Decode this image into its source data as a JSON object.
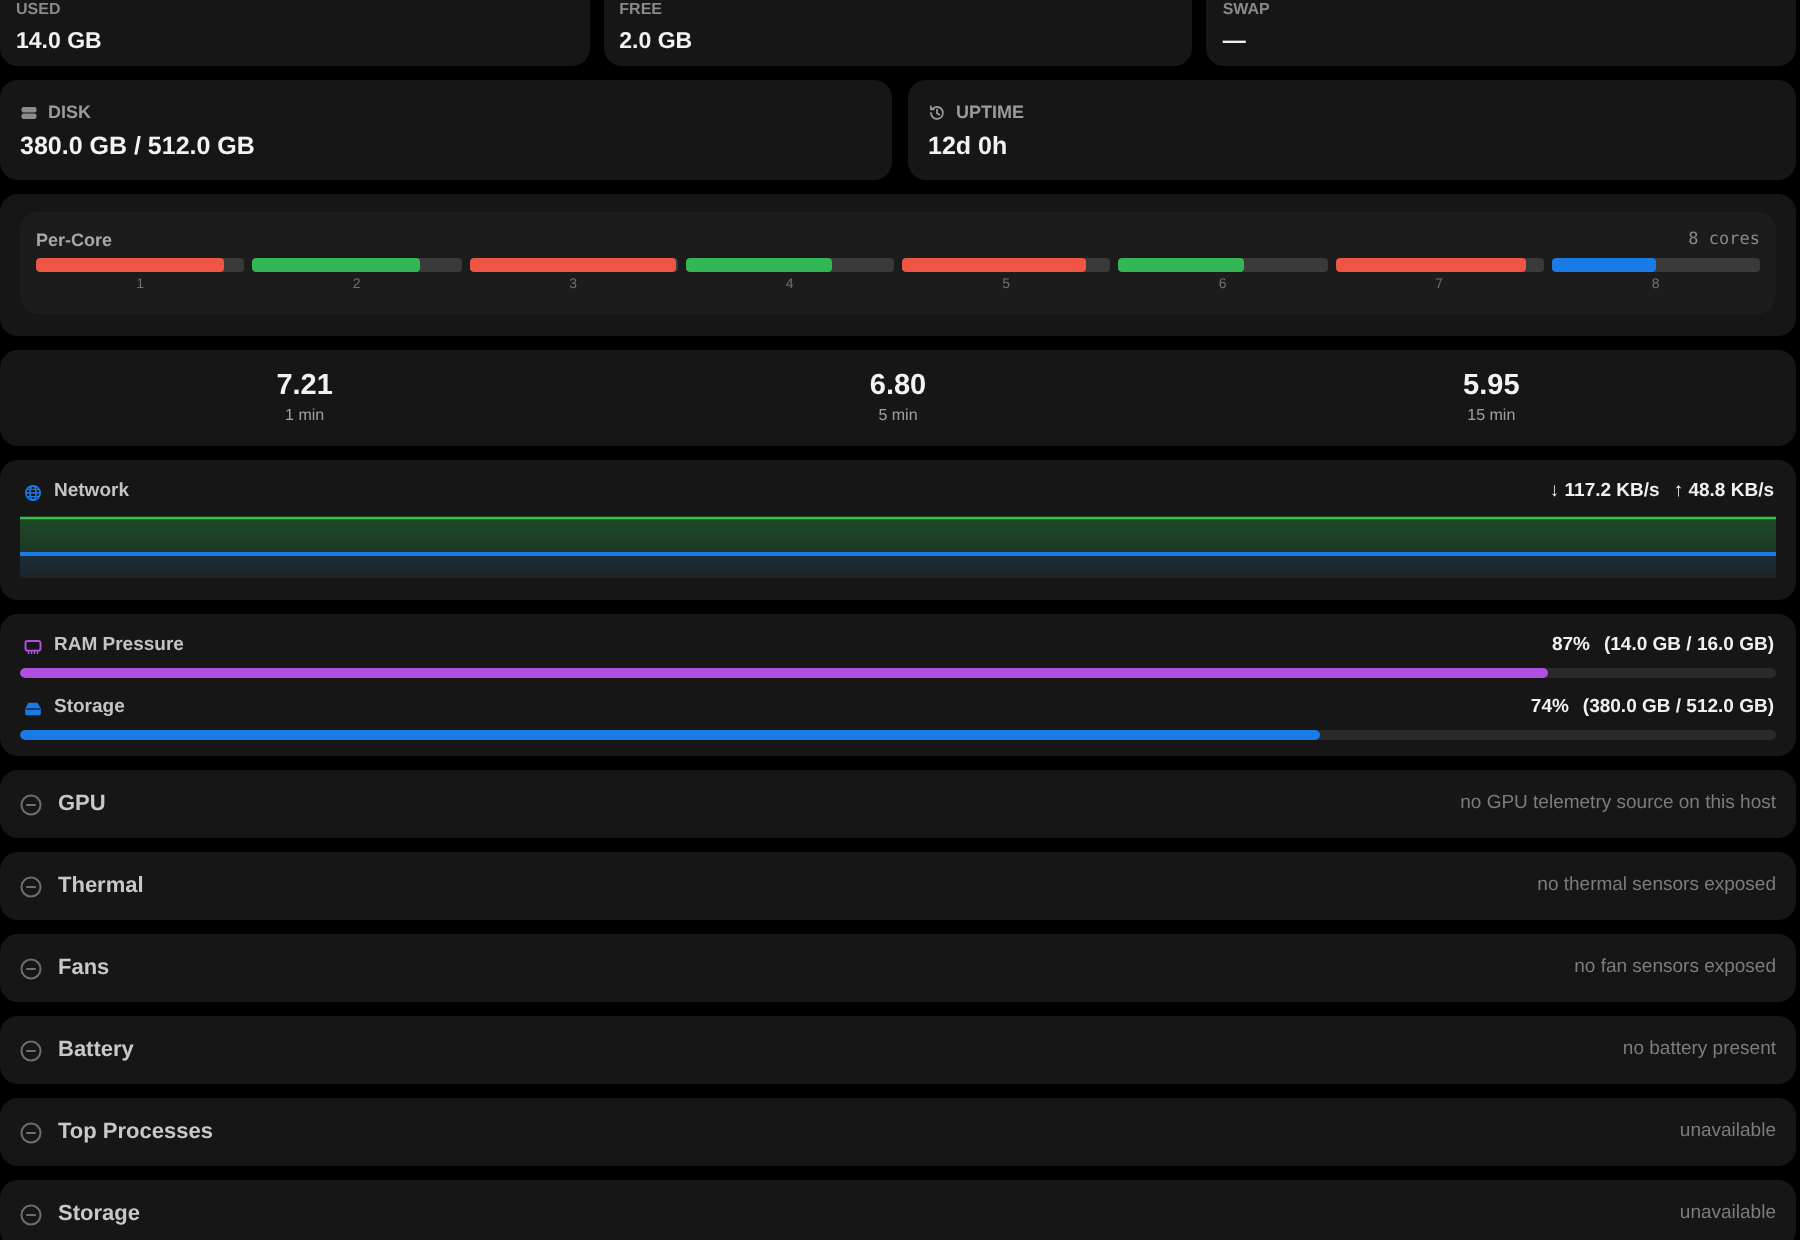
{
  "memory_cards": [
    {
      "label": "USED",
      "value": "14.0 GB"
    },
    {
      "label": "FREE",
      "value": "2.0 GB"
    },
    {
      "label": "SWAP",
      "value": "—"
    }
  ],
  "info_cards": [
    {
      "kind": "disk",
      "label": "DISK",
      "value": "380.0 GB / 512.0 GB"
    },
    {
      "kind": "uptime",
      "label": "UPTIME",
      "value": "12d 0h"
    }
  ],
  "per_core": {
    "title": "Per-Core",
    "count": "8 cores",
    "cores": [
      {
        "label": "1",
        "level": 0.9,
        "color": "#ef5545"
      },
      {
        "label": "2",
        "level": 0.8,
        "color": "#33b655"
      },
      {
        "label": "3",
        "level": 0.99,
        "color": "#ef5545"
      },
      {
        "label": "4",
        "level": 0.7,
        "color": "#33b655"
      },
      {
        "label": "5",
        "level": 0.88,
        "color": "#ef5545"
      },
      {
        "label": "6",
        "level": 0.6,
        "color": "#33b655"
      },
      {
        "label": "7",
        "level": 0.92,
        "color": "#ef5545"
      },
      {
        "label": "8",
        "level": 0.5,
        "color": "#1b7be6"
      }
    ]
  },
  "load_average": [
    {
      "value": "7.21",
      "label": "1 min"
    },
    {
      "value": "6.80",
      "label": "5 min"
    },
    {
      "value": "5.95",
      "label": "15 min"
    }
  ],
  "network": {
    "title": "Network",
    "download": "↓ 117.2 KB/s",
    "upload": "↑ 48.8 KB/s"
  },
  "usage": [
    {
      "kind": "memory",
      "name": "RAM Pressure",
      "percent": "87%",
      "detail": "(14.0 GB / 16.0 GB)",
      "level": 0.87,
      "color": "#b150e0"
    },
    {
      "kind": "storage",
      "name": "Storage",
      "percent": "74%",
      "detail": "(380.0 GB / 512.0 GB)",
      "level": 0.74,
      "color": "#1b7be6"
    }
  ],
  "sections": [
    {
      "title": "GPU",
      "note": "no GPU telemetry source on this host"
    },
    {
      "title": "Thermal",
      "note": "no thermal sensors exposed"
    },
    {
      "title": "Fans",
      "note": "no fan sensors exposed"
    },
    {
      "title": "Battery",
      "note": "no battery present"
    },
    {
      "title": "Top Processes",
      "note": "unavailable"
    },
    {
      "title": "Storage",
      "note": "unavailable"
    }
  ]
}
